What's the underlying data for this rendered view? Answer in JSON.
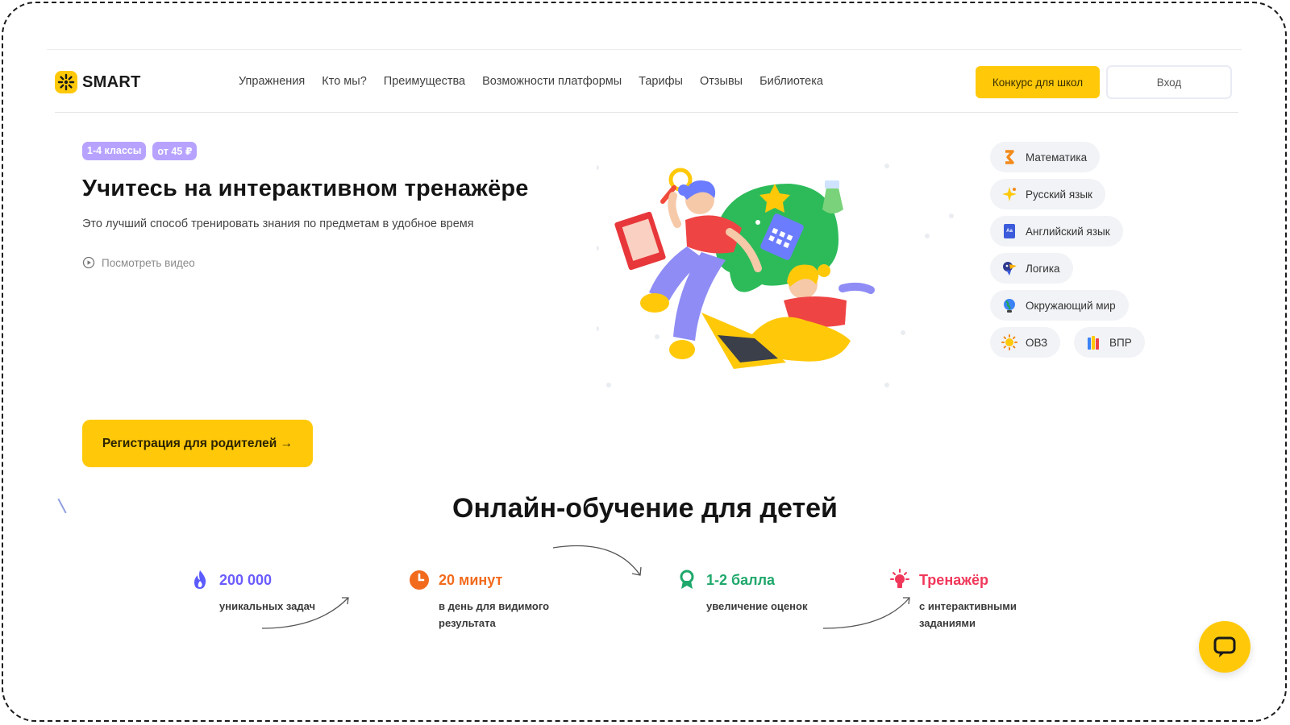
{
  "header": {
    "logo_text": "SMART",
    "nav": [
      {
        "label": "Упражнения"
      },
      {
        "label": "Кто мы?"
      },
      {
        "label": "Преимущества"
      },
      {
        "label": "Возможности платформы"
      },
      {
        "label": "Тарифы"
      },
      {
        "label": "Отзывы"
      },
      {
        "label": "Библиотека"
      }
    ],
    "contest_label": "Конкурс для школ",
    "login_label": "Вход"
  },
  "hero": {
    "badges": [
      "1-4 классы",
      "от 45 ₽"
    ],
    "title": "Учитесь на интерактивном тренажёре",
    "subtitle": "Это лучший способ тренировать знания по предметам в удобное время",
    "video_label": "Посмотреть видео",
    "register_label": "Регистрация для родителей →"
  },
  "subjects": [
    {
      "label": "Математика",
      "icon": "math-icon"
    },
    {
      "label": "Русский язык",
      "icon": "sparkle-icon"
    },
    {
      "label": "Английский язык",
      "icon": "book-icon"
    },
    {
      "label": "Логика",
      "icon": "toucan-icon"
    },
    {
      "label": "Окружающий мир",
      "icon": "globe-icon"
    },
    {
      "label": "ОВЗ",
      "icon": "sun-icon"
    },
    {
      "label": "ВПР",
      "icon": "pencils-icon"
    }
  ],
  "section": {
    "title": "Онлайн-обучение для детей"
  },
  "stats": [
    {
      "value": "200 000",
      "desc": "уникальных задач",
      "color": "#6b5cff",
      "icon": "fire-icon"
    },
    {
      "value": "20 минут",
      "desc": "в день для видимого результата",
      "color": "#f26b1d",
      "icon": "clock-icon"
    },
    {
      "value": "1-2 балла",
      "desc": "увеличение оценок",
      "color": "#1fa86b",
      "icon": "award-icon"
    },
    {
      "value": "Тренажёр",
      "desc": "с интерактивными заданиями",
      "color": "#f0385a",
      "icon": "lightbulb-icon"
    }
  ],
  "colors": {
    "accent": "#ffc90a",
    "badge": "#b7a3ff",
    "chip_bg": "#f1f3f6"
  }
}
